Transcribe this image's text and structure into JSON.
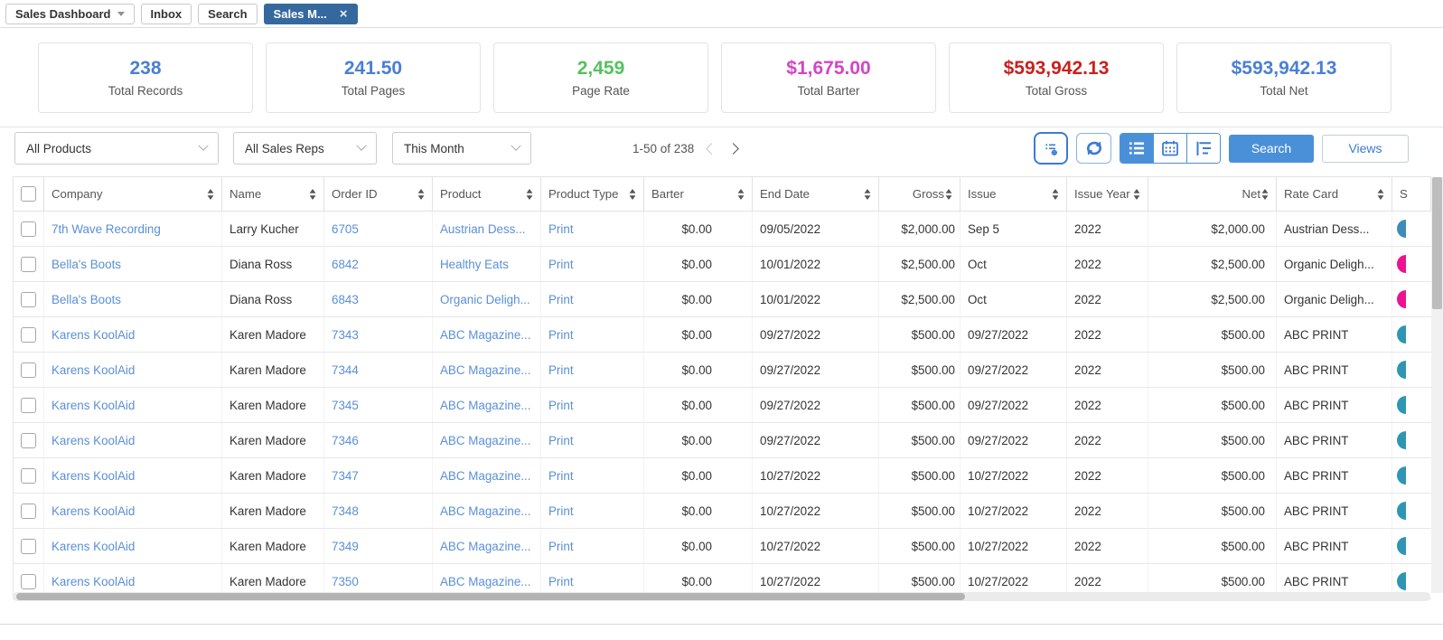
{
  "tabbar": {
    "dashboard_tab": "Sales Dashboard",
    "inbox_tab": "Inbox",
    "search_tab": "Search",
    "active_tab": "Sales M...",
    "close_label": "×"
  },
  "stats": {
    "cards": [
      {
        "value": "238",
        "label": "Total Records",
        "color": "#4a7fd4"
      },
      {
        "value": "241.50",
        "label": "Total Pages",
        "color": "#4a7fd4"
      },
      {
        "value": "2,459",
        "label": "Page Rate",
        "color": "#53c35c"
      },
      {
        "value": "$1,675.00",
        "label": "Total Barter",
        "color": "#d445c5"
      },
      {
        "value": "$593,942.13",
        "label": "Total Gross",
        "color": "#c9211e"
      },
      {
        "value": "$593,942.13",
        "label": "Total Net",
        "color": "#4a7fd4"
      }
    ]
  },
  "filters": {
    "products": "All Products",
    "sales_reps": "All Sales Reps",
    "period": "This Month"
  },
  "pagination": {
    "range": "1-50 of 238"
  },
  "toolbar": {
    "search_button": "Search",
    "views_button": "Views"
  },
  "table": {
    "columns": [
      {
        "label": ""
      },
      {
        "label": "Company"
      },
      {
        "label": "Name"
      },
      {
        "label": "Order ID"
      },
      {
        "label": "Product"
      },
      {
        "label": "Product Type"
      },
      {
        "label": "Barter"
      },
      {
        "label": "End Date"
      },
      {
        "label": "Gross"
      },
      {
        "label": "Issue"
      },
      {
        "label": "Issue Year"
      },
      {
        "label": "Net"
      },
      {
        "label": "Rate Card"
      },
      {
        "label": "S"
      }
    ],
    "rows": [
      {
        "company": "7th Wave Recording",
        "name": "Larry Kucher",
        "order_id": "6705",
        "product": "Austrian Dess...",
        "product_type": "Print",
        "barter": "$0.00",
        "end_date": "09/05/2022",
        "gross": "$2,000.00",
        "issue": "Sep 5",
        "issue_year": "2022",
        "net": "$2,000.00",
        "rate_card": "Austrian Dess...",
        "badge_color": "#3e8cba"
      },
      {
        "company": "Bella's Boots",
        "name": "Diana Ross",
        "order_id": "6842",
        "product": "Healthy Eats",
        "product_type": "Print",
        "barter": "$0.00",
        "end_date": "10/01/2022",
        "gross": "$2,500.00",
        "issue": "Oct",
        "issue_year": "2022",
        "net": "$2,500.00",
        "rate_card": "Organic Deligh...",
        "badge_color": "#ec1290"
      },
      {
        "company": "Bella's Boots",
        "name": "Diana Ross",
        "order_id": "6843",
        "product": "Organic Deligh...",
        "product_type": "Print",
        "barter": "$0.00",
        "end_date": "10/01/2022",
        "gross": "$2,500.00",
        "issue": "Oct",
        "issue_year": "2022",
        "net": "$2,500.00",
        "rate_card": "Organic Deligh...",
        "badge_color": "#ec1290"
      },
      {
        "company": "Karens KoolAid",
        "name": "Karen Madore",
        "order_id": "7343",
        "product": "ABC Magazine...",
        "product_type": "Print",
        "barter": "$0.00",
        "end_date": "09/27/2022",
        "gross": "$500.00",
        "issue": "09/27/2022",
        "issue_year": "2022",
        "net": "$500.00",
        "rate_card": "ABC PRINT",
        "badge_color": "#2e96b4"
      },
      {
        "company": "Karens KoolAid",
        "name": "Karen Madore",
        "order_id": "7344",
        "product": "ABC Magazine...",
        "product_type": "Print",
        "barter": "$0.00",
        "end_date": "09/27/2022",
        "gross": "$500.00",
        "issue": "09/27/2022",
        "issue_year": "2022",
        "net": "$500.00",
        "rate_card": "ABC PRINT",
        "badge_color": "#2e96b4"
      },
      {
        "company": "Karens KoolAid",
        "name": "Karen Madore",
        "order_id": "7345",
        "product": "ABC Magazine...",
        "product_type": "Print",
        "barter": "$0.00",
        "end_date": "09/27/2022",
        "gross": "$500.00",
        "issue": "09/27/2022",
        "issue_year": "2022",
        "net": "$500.00",
        "rate_card": "ABC PRINT",
        "badge_color": "#2e96b4"
      },
      {
        "company": "Karens KoolAid",
        "name": "Karen Madore",
        "order_id": "7346",
        "product": "ABC Magazine...",
        "product_type": "Print",
        "barter": "$0.00",
        "end_date": "09/27/2022",
        "gross": "$500.00",
        "issue": "09/27/2022",
        "issue_year": "2022",
        "net": "$500.00",
        "rate_card": "ABC PRINT",
        "badge_color": "#2e96b4"
      },
      {
        "company": "Karens KoolAid",
        "name": "Karen Madore",
        "order_id": "7347",
        "product": "ABC Magazine...",
        "product_type": "Print",
        "barter": "$0.00",
        "end_date": "10/27/2022",
        "gross": "$500.00",
        "issue": "10/27/2022",
        "issue_year": "2022",
        "net": "$500.00",
        "rate_card": "ABC PRINT",
        "badge_color": "#2e96b4"
      },
      {
        "company": "Karens KoolAid",
        "name": "Karen Madore",
        "order_id": "7348",
        "product": "ABC Magazine...",
        "product_type": "Print",
        "barter": "$0.00",
        "end_date": "10/27/2022",
        "gross": "$500.00",
        "issue": "10/27/2022",
        "issue_year": "2022",
        "net": "$500.00",
        "rate_card": "ABC PRINT",
        "badge_color": "#2e96b4"
      },
      {
        "company": "Karens KoolAid",
        "name": "Karen Madore",
        "order_id": "7349",
        "product": "ABC Magazine...",
        "product_type": "Print",
        "barter": "$0.00",
        "end_date": "10/27/2022",
        "gross": "$500.00",
        "issue": "10/27/2022",
        "issue_year": "2022",
        "net": "$500.00",
        "rate_card": "ABC PRINT",
        "badge_color": "#2e96b4"
      },
      {
        "company": "Karens KoolAid",
        "name": "Karen Madore",
        "order_id": "7350",
        "product": "ABC Magazine...",
        "product_type": "Print",
        "barter": "$0.00",
        "end_date": "10/27/2022",
        "gross": "$500.00",
        "issue": "10/27/2022",
        "issue_year": "2022",
        "net": "$500.00",
        "rate_card": "ABC PRINT",
        "badge_color": "#2e96b4"
      }
    ]
  }
}
